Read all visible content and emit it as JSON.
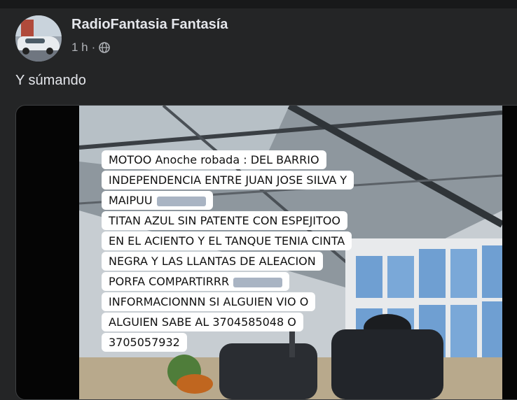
{
  "post": {
    "author": "RadioFantasia Fantasía",
    "time": "1 h",
    "separator": "·",
    "privacy_icon": "globe-icon",
    "caption": "Y súmando"
  },
  "image_text": {
    "lines": [
      "MOTOO  Anoche robada : DEL BARRIO",
      "INDEPENDENCIA  ENTRE JUAN JOSE SILVA Y",
      "MAIPUU",
      "TITAN AZUL SIN PATENTE CON  ESPEJITOO",
      "EN EL ACIENTO  Y EL TANQUE TENIA CINTA",
      "NEGRA Y LAS LLANTAS DE ALEACION",
      "PORFA COMPARTIRRR",
      "INFORMACIONNN  SI ALGUIEN VIO O",
      "ALGUIEN SABE AL 3704585048 O",
      "3705057932"
    ]
  },
  "colors": {
    "background": "#242526",
    "text_primary": "#e4e6eb",
    "text_secondary": "#b0b3b8"
  }
}
